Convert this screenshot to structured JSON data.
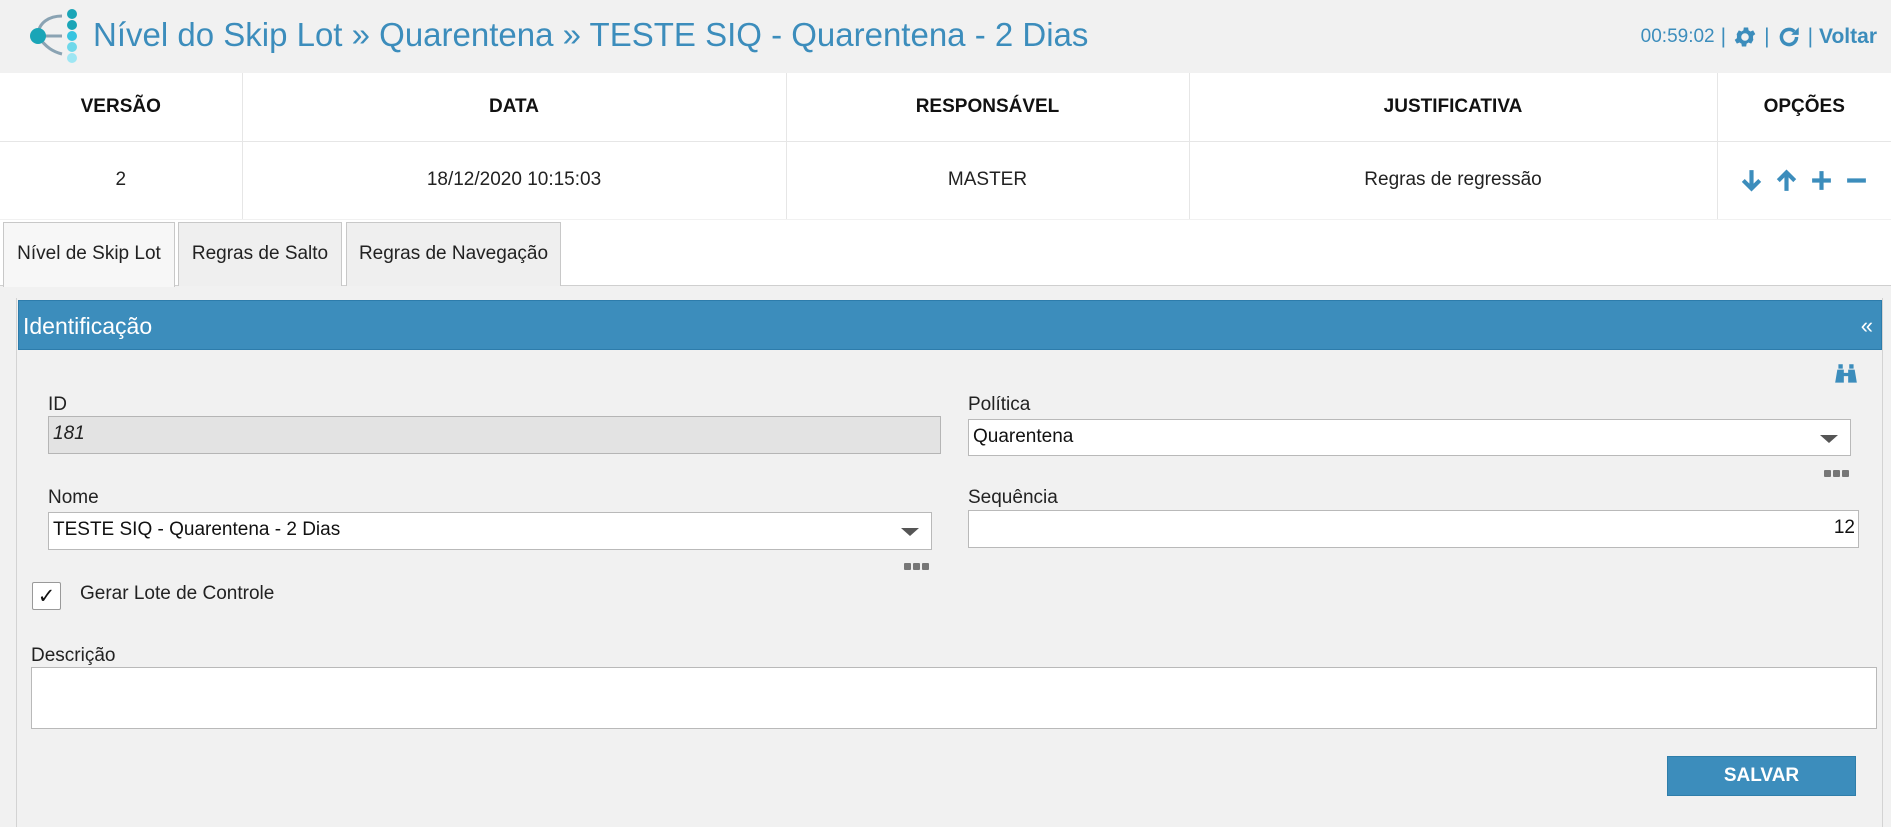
{
  "header": {
    "title": "Nível do Skip Lot » Quarentena » TESTE SIQ - Quarentena - 2 Dias",
    "clock": "00:59:02",
    "sep": "|",
    "back_label": "Voltar",
    "icons": [
      "logo-icon",
      "gear-icon",
      "refresh-icon"
    ]
  },
  "versions": {
    "columns": [
      "VERSÃO",
      "DATA",
      "RESPONSÁVEL",
      "JUSTIFICATIVA",
      "OPÇÕES"
    ],
    "rows": [
      {
        "version": "2",
        "date": "18/12/2020 10:15:03",
        "responsible": "MASTER",
        "justification": "Regras de regressão"
      }
    ],
    "option_icons": [
      "arrow-down-icon",
      "arrow-up-icon",
      "plus-icon",
      "minus-icon"
    ]
  },
  "tabs": [
    {
      "label": "Nível de Skip Lot",
      "active": true
    },
    {
      "label": "Regras de Salto",
      "active": false
    },
    {
      "label": "Regras de Navegação",
      "active": false
    }
  ],
  "panel": {
    "title": "Identificação",
    "collapse": "«",
    "fields": {
      "id_label": "ID",
      "id_value": "181",
      "politica_label": "Política",
      "politica_value": "Quarentena",
      "nome_label": "Nome",
      "nome_value": "TESTE SIQ - Quarentena - 2 Dias",
      "sequencia_label": "Sequência",
      "sequencia_value": "12",
      "gerar_lote_label": "Gerar Lote de Controle",
      "gerar_lote_checked": true,
      "checkmark": "✓",
      "descricao_label": "Descrição",
      "descricao_value": ""
    },
    "save_label": "SALVAR"
  },
  "colors": {
    "accent": "#3c8dbc",
    "background": "#f1f1f1"
  }
}
